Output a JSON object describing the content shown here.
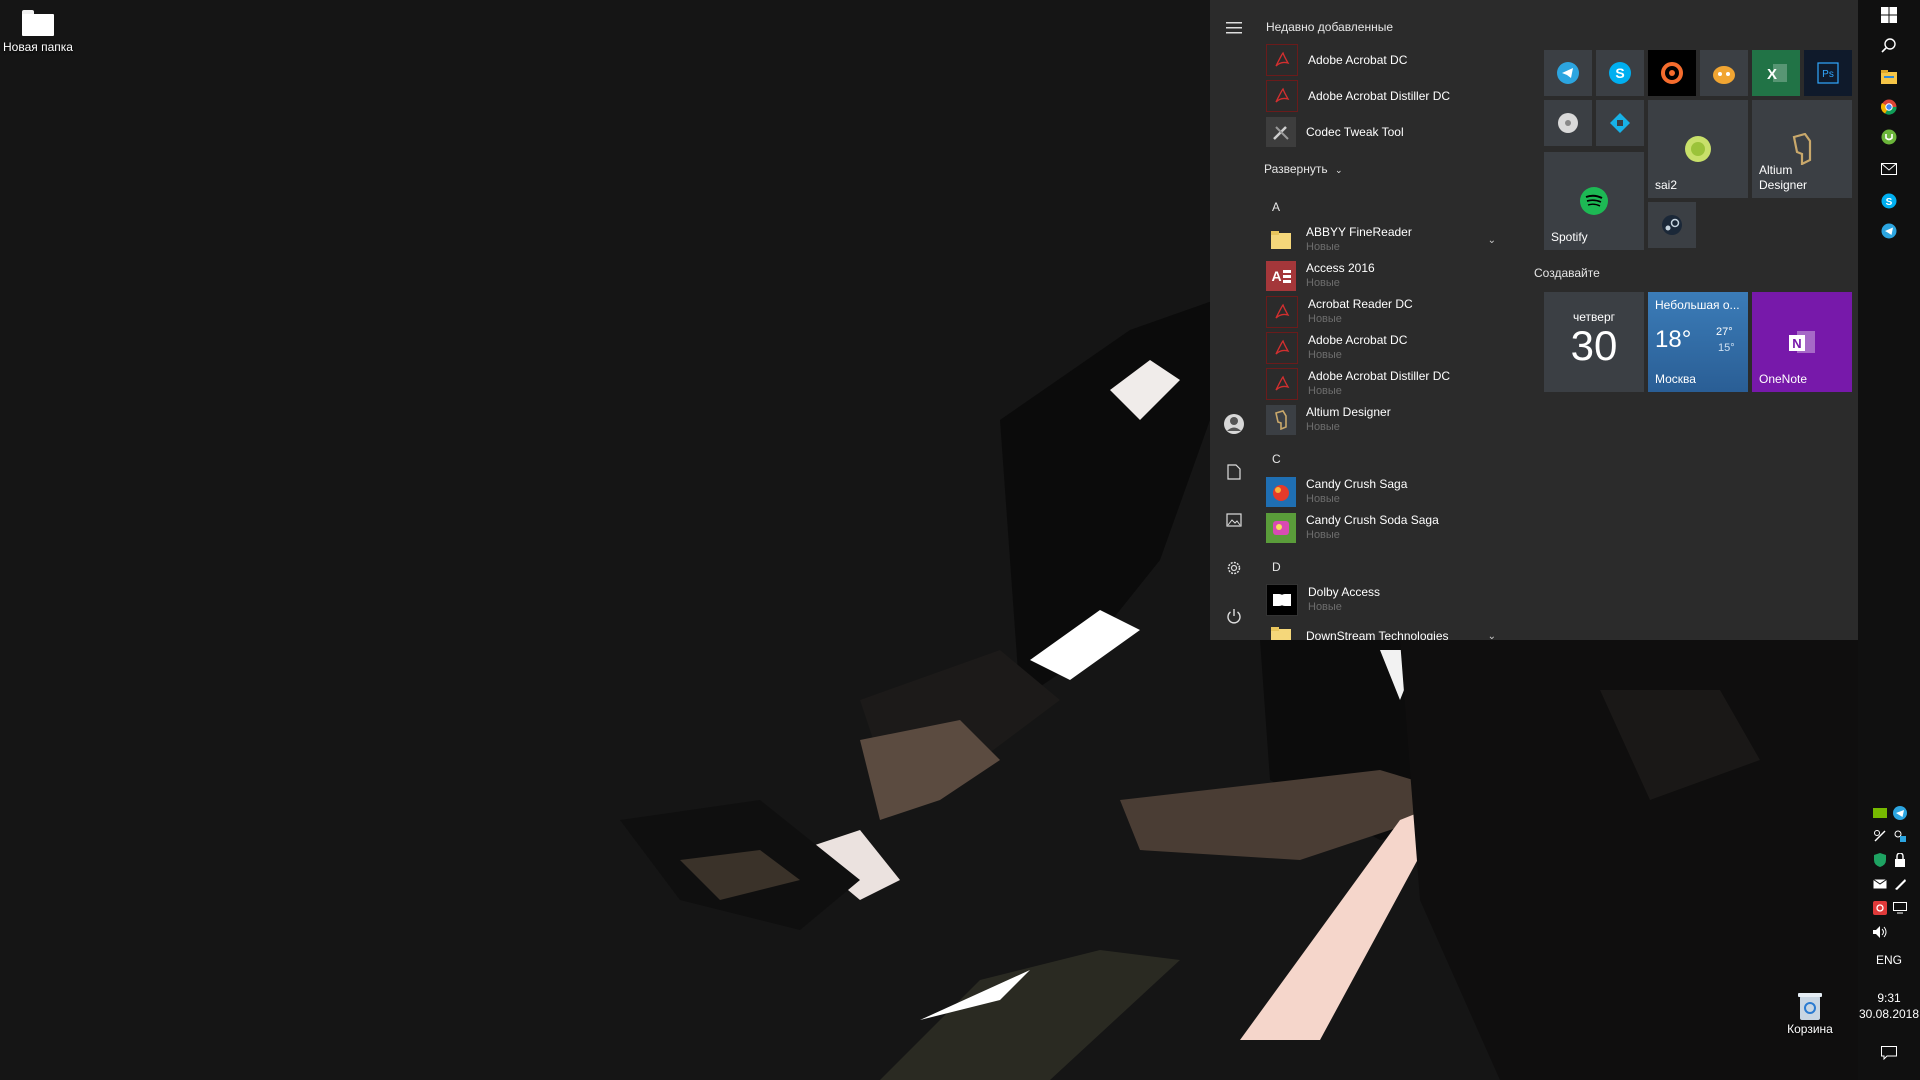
{
  "desktop": {
    "icons": [
      {
        "label": "Новая папка"
      },
      {
        "label": "Корзина"
      }
    ]
  },
  "start_menu": {
    "recent_header": "Недавно добавленные",
    "recent": [
      {
        "name": "Adobe Acrobat DC",
        "icon": "acrobat-icon"
      },
      {
        "name": "Adobe Acrobat Distiller DC",
        "icon": "acrobat-distiller-icon"
      },
      {
        "name": "Codec Tweak Tool",
        "icon": "tools-icon"
      }
    ],
    "expand_label": "Развернуть",
    "sections": [
      {
        "letter": "A",
        "items": [
          {
            "name": "ABBYY FineReader",
            "sub": "Новые",
            "icon": "folder-icon",
            "expandable": true
          },
          {
            "name": "Access 2016",
            "sub": "Новые",
            "icon": "access-icon"
          },
          {
            "name": "Acrobat Reader DC",
            "sub": "Новые",
            "icon": "acrobat-reader-icon"
          },
          {
            "name": "Adobe Acrobat DC",
            "sub": "Новые",
            "icon": "acrobat-icon"
          },
          {
            "name": "Adobe Acrobat Distiller DC",
            "sub": "Новые",
            "icon": "acrobat-distiller-icon"
          },
          {
            "name": "Altium Designer",
            "sub": "Новые",
            "icon": "altium-icon"
          }
        ]
      },
      {
        "letter": "C",
        "items": [
          {
            "name": "Candy Crush Saga",
            "sub": "Новые",
            "icon": "candy-crush-icon"
          },
          {
            "name": "Candy Crush Soda Saga",
            "sub": "Новые",
            "icon": "candy-crush-soda-icon"
          }
        ]
      },
      {
        "letter": "D",
        "items": [
          {
            "name": "Dolby Access",
            "sub": "Новые",
            "icon": "dolby-icon"
          },
          {
            "name": "DownStream Technologies",
            "sub": "",
            "icon": "folder-icon",
            "expandable": true
          }
        ]
      }
    ],
    "rail": [
      "hamburger-icon",
      "user-avatar-icon",
      "documents-icon",
      "pictures-icon",
      "settings-icon",
      "power-icon"
    ],
    "tiles": {
      "group_title": "Создавайте",
      "small": [
        "telegram-icon",
        "skype-icon",
        "origin-icon",
        "cat-app-icon",
        "excel-icon",
        "photoshop-icon",
        "disk-app-icon",
        "kodi-icon",
        "steam-icon"
      ],
      "sai": {
        "label": "sai2"
      },
      "altium": {
        "label": "Altium Designer"
      },
      "spotify": {
        "label": "Spotify"
      },
      "calendar": {
        "day": "четверг",
        "date": "30"
      },
      "weather": {
        "condition": "Небольшая о...",
        "temp": "18°",
        "high": "27°",
        "low": "15°",
        "city": "Москва"
      },
      "onenote": {
        "label": "OneNote"
      }
    }
  },
  "taskbar": {
    "lang": "ENG",
    "time": "9:31",
    "date": "30.08.2018",
    "pinned": [
      "windows-logo-icon",
      "search-icon",
      "file-explorer-icon",
      "chrome-icon",
      "utorrent-icon",
      "mail-icon",
      "skype-icon",
      "telegram-icon"
    ]
  },
  "colors": {
    "menu_bg": "#2b2b2b",
    "tile_bg": "#3b3f44",
    "weather_bg": "#2a6aa6",
    "onenote_bg": "#7719aa",
    "excel_bg": "#217346",
    "taskbar_bg": "#101010"
  }
}
